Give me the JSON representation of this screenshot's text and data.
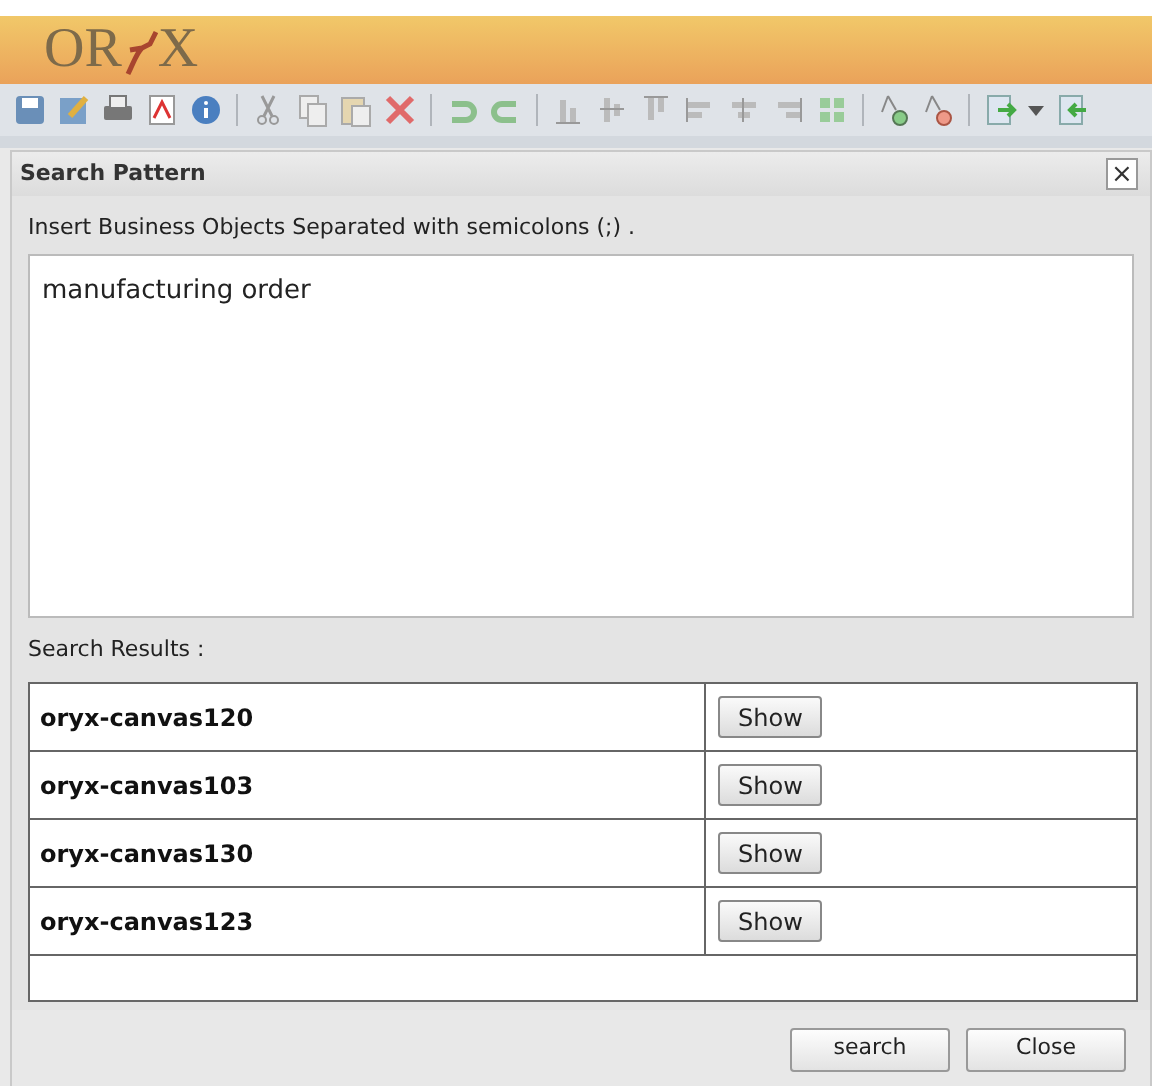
{
  "logo": {
    "left": "OR",
    "right": "X"
  },
  "dialog": {
    "title": "Search Pattern",
    "close": "×",
    "instruction": "Insert Business Objects Separated with semicolons (;) .",
    "query": "manufacturing order",
    "results_label": "Search Results :",
    "results": [
      {
        "name": "oryx-canvas120",
        "action": "Show"
      },
      {
        "name": "oryx-canvas103",
        "action": "Show"
      },
      {
        "name": "oryx-canvas130",
        "action": "Show"
      },
      {
        "name": "oryx-canvas123",
        "action": "Show"
      }
    ],
    "buttons": [
      "search",
      "Close"
    ]
  }
}
